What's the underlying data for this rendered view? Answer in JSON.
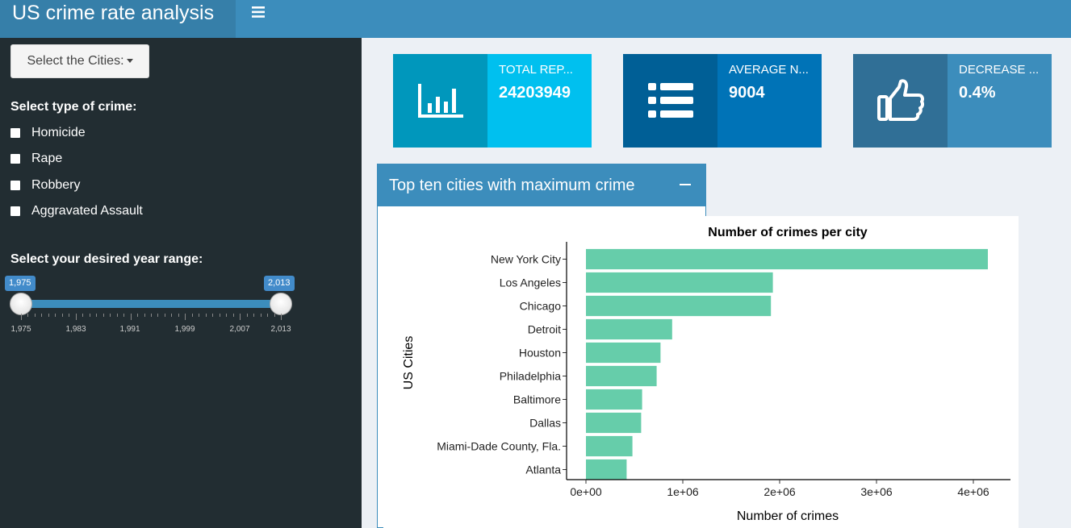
{
  "header": {
    "title": "US crime rate analysis",
    "menu_icon": "hamburger-icon",
    "color": "#3c8dbc"
  },
  "sidebar": {
    "cities_button": "Select the Cities:",
    "crime_type_label": "Select type of crime:",
    "crime_types": [
      "Homicide",
      "Rape",
      "Robbery",
      "Aggravated Assault"
    ],
    "year_label": "Select your desired year range:",
    "slider": {
      "min_value": "1,975",
      "max_value": "2,013",
      "tick_labels": [
        "1,975",
        "1,983",
        "1,991",
        "1,999",
        "2,007",
        "2,013"
      ]
    }
  },
  "info_boxes": [
    {
      "title": "TOTAL REP...",
      "value": "24203949",
      "icon": "bar-chart-icon",
      "icon_bg": "#0097bc",
      "bg": "#00c0ef"
    },
    {
      "title": "AVERAGE N...",
      "value": "9004",
      "icon": "list-icon",
      "icon_bg": "#005f96",
      "bg": "#0073b7"
    },
    {
      "title": "DECREASE ...",
      "value": "0.4%",
      "icon": "thumbs-up-icon",
      "icon_bg": "#306f96",
      "bg": "#3c8dbc"
    }
  ],
  "box": {
    "title": "Top ten cities with maximum crime"
  },
  "chart_data": {
    "type": "bar",
    "orientation": "horizontal",
    "title": "Number of crimes per city",
    "xlabel": "Number of crimes",
    "ylabel": "US Cities",
    "categories": [
      "New York City",
      "Los Angeles",
      "Chicago",
      "Detroit",
      "Houston",
      "Philadelphia",
      "Baltimore",
      "Dallas",
      "Miami-Dade County, Fla.",
      "Atlanta"
    ],
    "values": [
      4150000,
      1930000,
      1910000,
      890000,
      770000,
      730000,
      580000,
      570000,
      480000,
      420000
    ],
    "xlim": [
      0,
      4400000
    ],
    "x_ticks": [
      0,
      1000000,
      2000000,
      3000000,
      4000000
    ],
    "x_tick_labels": [
      "0e+00",
      "1e+06",
      "2e+06",
      "3e+06",
      "4e+06"
    ],
    "bar_color": "#66cdaa",
    "grid": false
  }
}
